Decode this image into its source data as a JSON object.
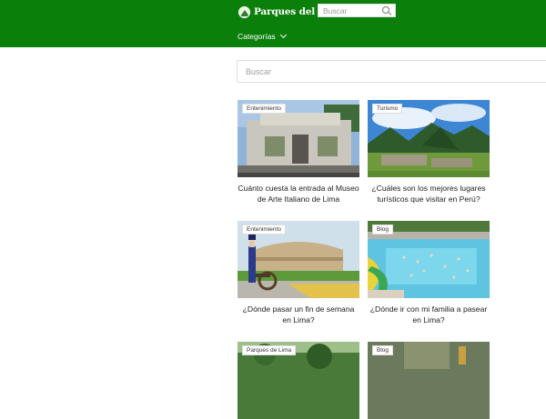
{
  "header": {
    "brand": "Parques del Perú",
    "search_placeholder": "Buscar",
    "nav_categories": "Categorías"
  },
  "main": {
    "search_placeholder": "Buscar"
  },
  "posts": [
    {
      "category": "Entenimiento",
      "title": "Cuánto cuesta la entrada al Museo de Arte Italiano de Lima"
    },
    {
      "category": "Turismo",
      "title": "¿Cuáles son los mejores lugares turísticos que visitar en Perú?"
    },
    {
      "category": "Entenimiento",
      "title": "¿Dónde pasar un fin de semana en Lima?"
    },
    {
      "category": "Blog",
      "title": "¿Dónde ir con mi familia a pasear en Lima?"
    },
    {
      "category": "Parques de Lima",
      "title": ""
    },
    {
      "category": "Blog",
      "title": ""
    }
  ],
  "colors": {
    "header_bg": "#0a7f0a",
    "text": "#222222"
  },
  "icons": {
    "logo": "park-logo-icon",
    "search": "search-icon",
    "dropdown": "chevron-down-icon"
  }
}
